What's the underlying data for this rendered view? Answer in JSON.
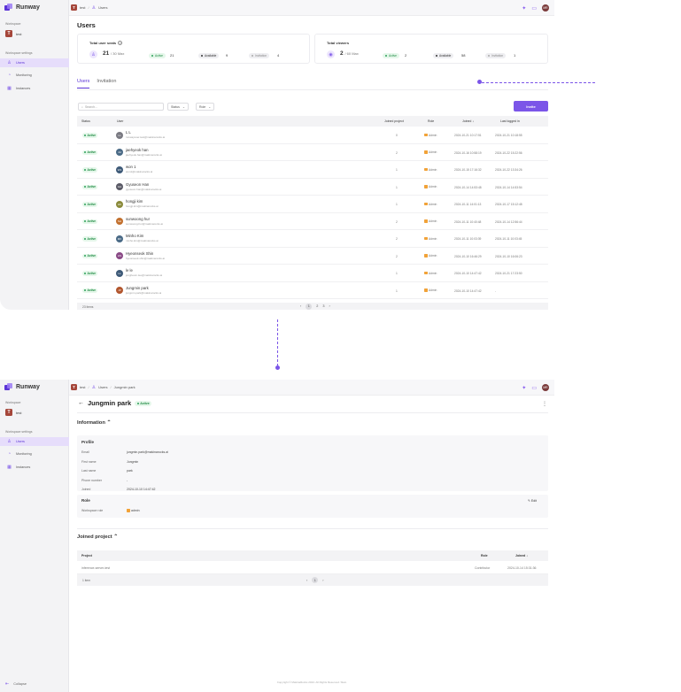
{
  "brand": {
    "name": "Runway"
  },
  "sidebar": {
    "workspace_label": "Workspace",
    "workspace_initial": "T",
    "workspace_name": "test",
    "settings_label": "Workspace settings",
    "items": [
      {
        "label": "Users",
        "icon": "users-icon"
      },
      {
        "label": "Monitoring",
        "icon": "monitoring-icon"
      },
      {
        "label": "Instances",
        "icon": "instances-icon"
      }
    ],
    "collapse_label": "Collapse"
  },
  "screen1": {
    "breadcrumb": {
      "ws": "test",
      "page": "Users"
    },
    "title": "Users",
    "seats_card": {
      "title": "Total user seats",
      "value": "21",
      "max": "/ 30 Max",
      "pills": [
        {
          "label": "Active",
          "count": "21",
          "color": "#2ea05a",
          "bg": "#e5f7ea"
        },
        {
          "label": "Available",
          "count": "9",
          "color": "#333333",
          "bg": "#eeeef1"
        },
        {
          "label": "Invitation",
          "count": "4",
          "color": "#888888",
          "bg": "#eeeef1"
        }
      ]
    },
    "viewers_card": {
      "title": "Total viewers",
      "value": "2",
      "max": "/ 60 Max",
      "pills": [
        {
          "label": "Active",
          "count": "2",
          "color": "#2ea05a",
          "bg": "#e5f7ea"
        },
        {
          "label": "Available",
          "count": "58",
          "color": "#333333",
          "bg": "#eeeef1"
        },
        {
          "label": "Invitation",
          "count": "1",
          "color": "#888888",
          "bg": "#eeeef1"
        }
      ]
    },
    "tabs": [
      "Users",
      "Invitation"
    ],
    "search_placeholder": "Search...",
    "filters": [
      "Status",
      "Role"
    ],
    "invite_label": "Invite",
    "columns": [
      "Status",
      "User",
      "Joined project",
      "Role",
      "Joined",
      "Last logged in"
    ],
    "rows": [
      {
        "status": "Active",
        "initials": "LL",
        "color": "#7a7a82",
        "name": "L L",
        "email": "runwayuser.test@makinarocks.ai",
        "joined_project": "0",
        "role": "Admin",
        "joined": "2024-10-21 10:17:51",
        "last": "2024-10-21 10:18:55"
      },
      {
        "status": "Active",
        "initials": "JH",
        "color": "#4a6a86",
        "name": "jaehyeok han",
        "email": "jaehyeok.han@makinarocks.ai",
        "joined_project": "2",
        "role": "Admin",
        "joined": "2024-10-16 10:58:19",
        "last": "2024-10-22 15:22:56"
      },
      {
        "status": "Active",
        "initials": "W1",
        "color": "#3e5a78",
        "name": "won 1",
        "email": "won1@makinarocks.ai",
        "joined_project": "1",
        "role": "Admin",
        "joined": "2024-10-15 17:16:32",
        "last": "2024-10-22 13:34:26"
      },
      {
        "status": "Active",
        "initials": "GH",
        "color": "#5a5a66",
        "name": "Gyuseon Han",
        "email": "gyuseon.han@makinarocks.ai",
        "joined_project": "1",
        "role": "Admin",
        "joined": "2024-10-14 14:53:48",
        "last": "2024-10-14 14:53:54"
      },
      {
        "status": "Active",
        "initials": "HK",
        "color": "#8a8a3a",
        "name": "hongji kim",
        "email": "hongji.kim@makinarocks.ai",
        "joined_project": "1",
        "role": "Admin",
        "joined": "2024-10-11 14:01:13",
        "last": "2024-10-17 15:12:48"
      },
      {
        "status": "Active",
        "initials": "SH",
        "color": "#c2702e",
        "name": "sunwoong hur",
        "email": "sunwoong.hur@makinarocks.ai",
        "joined_project": "2",
        "role": "Admin",
        "joined": "2024-10-11 10:40:48",
        "last": "2024-10-14 12:56:44"
      },
      {
        "status": "Active",
        "initials": "MK",
        "color": "#4a6a86",
        "name": "Minho Kim",
        "email": "minho.kim@makinarocks.ai",
        "joined_project": "2",
        "role": "Admin",
        "joined": "2024-10-11 10:03:39",
        "last": "2024-10-11 10:03:45"
      },
      {
        "status": "Active",
        "initials": "HS",
        "color": "#8a4a86",
        "name": "Hyeonseok Shin",
        "email": "hyeonseok.shin@makinarocks.ai",
        "joined_project": "2",
        "role": "Admin",
        "joined": "2024-10-10 16:46:29",
        "last": "2024-10-10 16:06:23"
      },
      {
        "status": "Active",
        "initials": "LL",
        "color": "#3e5a78",
        "name": "le le",
        "email": "jongheum.lee@makinarocks.ai",
        "joined_project": "1",
        "role": "Admin",
        "joined": "2024-10-10 14:47:42",
        "last": "2024-10-21 17:23:50"
      },
      {
        "status": "Active",
        "initials": "JP",
        "color": "#b2562e",
        "name": "Jungmin park",
        "email": "jungmin.park@makinarocks.ai",
        "joined_project": "1",
        "role": "Admin",
        "joined": "2024-10-10 14:47:42",
        "last": "-"
      }
    ],
    "footer_count": "23 items",
    "pages": [
      "1",
      "2",
      "3"
    ]
  },
  "screen2": {
    "breadcrumb": {
      "ws": "test",
      "section": "Users",
      "page": "Jungmin park"
    },
    "title": "Jungmin park",
    "status": "Active",
    "info_title": "Information",
    "profile_title": "Profile",
    "profile": [
      {
        "k": "Email",
        "v": "jungmin.park@makinarocks.ai"
      },
      {
        "k": "First name",
        "v": "Jungmin"
      },
      {
        "k": "Last name",
        "v": "park"
      },
      {
        "k": "Phone number",
        "v": "-"
      },
      {
        "k": "Joined",
        "v": "2024-10-10 14:47:42"
      }
    ],
    "role_title": "Role",
    "edit_label": "Edit",
    "role_key": "Workspace role",
    "role_value": "admin",
    "jp_title": "Joined project",
    "jp_columns": [
      "Project",
      "Role",
      "Joined"
    ],
    "jp_rows": [
      {
        "project": "inference-server-test",
        "role": "Contributor",
        "joined": "2024-10-14 15:31:36"
      }
    ],
    "jp_count": "1 item",
    "jp_page": "1",
    "footer": "Copyright © MakinaRocks 2024. All Rights Reserved. Slam"
  }
}
